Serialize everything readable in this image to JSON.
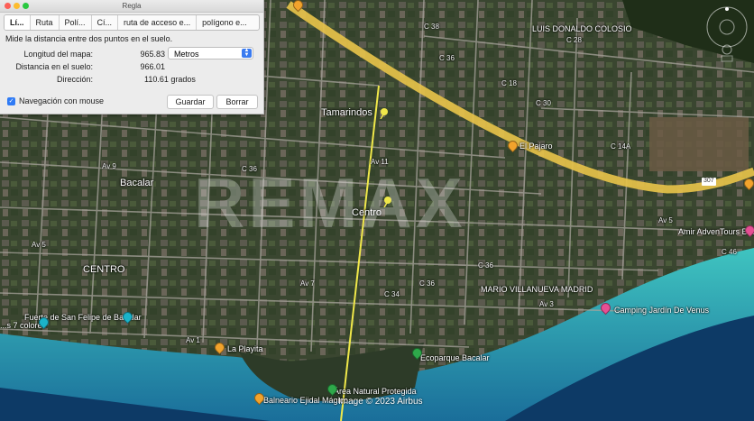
{
  "ruler_window": {
    "title": "Regla",
    "tabs": [
      {
        "label": "Lí..."
      },
      {
        "label": "Ruta"
      },
      {
        "label": "Polí..."
      },
      {
        "label": "Cí..."
      },
      {
        "label": "ruta de acceso e..."
      },
      {
        "label": "polígono e..."
      }
    ],
    "description": "Mide la distancia entre dos puntos en el suelo.",
    "map_length_label": "Longitud del mapa:",
    "map_length_value": "965.83",
    "unit": "Metros",
    "ground_length_label": "Distancia en el suelo:",
    "ground_length_value": "966.01",
    "heading_label": "Dirección:",
    "heading_value": "110.61 grados",
    "mouse_nav_label": "Navegación con mouse",
    "mouse_nav_checked": true,
    "save_label": "Guardar",
    "clear_label": "Borrar"
  },
  "map": {
    "places": {
      "luis_donaldo_colosio": "LUIS DONALDO COLOSIO",
      "tamarindos": "Tamarindos",
      "bacalar": "Bacalar",
      "centro_pin": "Centro",
      "centro_area": "CENTRO",
      "mario_villanueva": "MARIO VILLANUEVA MADRID",
      "el_pajaro": "El Pajaro",
      "amir": "Amir AdvenTours Bacalar",
      "camping": "Camping Jardín De Venus",
      "fuerte": "Fuerte de San Felipe de Bacalar",
      "siete_colores": "...s 7 colores",
      "la_playita": "La Playita",
      "ecoparque": "Ecoparque Bacalar",
      "area_natural": "Área Natural Protegida",
      "balneario": "Balneario Ejidal Mágico"
    },
    "roads": {
      "c36a": "C 36",
      "c36b": "C 36",
      "c36c": "C 36",
      "c36d": "C 36",
      "c38": "C 38",
      "c30": "C 30",
      "c28": "C 28",
      "c14a": "C 14A",
      "c18": "C 18",
      "c34": "C 34",
      "c46": "C 46",
      "av1": "Av 1",
      "av3": "Av 3",
      "av5a": "Av 5",
      "av5b": "Av 5",
      "av7": "Av 7",
      "av9": "Av 9",
      "av11": "Av 11",
      "route_shield": "307"
    },
    "watermark": "REMAX",
    "imagery_credit": "Image © 2023 Airbus"
  },
  "colors": {
    "highway": "#e6c24a",
    "ruler_line": "#f0e84a",
    "water_shallow": "#3fc4c0",
    "water_deep": "#0d3a66"
  }
}
